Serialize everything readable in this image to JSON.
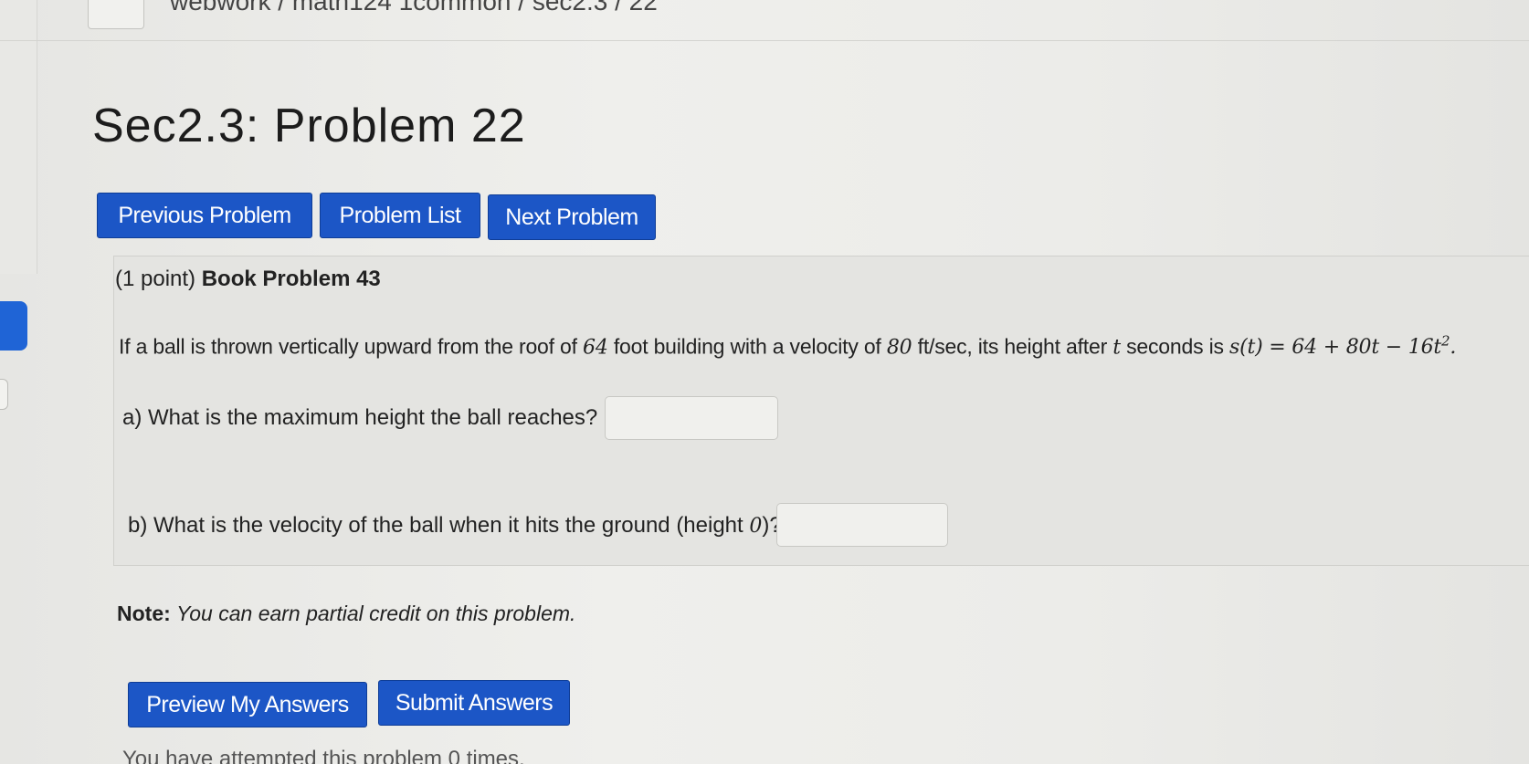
{
  "header": {
    "breadcrumb": "webwork / math124 1common / sec2.3 / 22"
  },
  "page_title": "Sec2.3: Problem 22",
  "nav": {
    "previous": "Previous Problem",
    "list": "Problem List",
    "next": "Next Problem"
  },
  "problem": {
    "points": "(1 point)",
    "book_ref": "Book Problem 43",
    "statement_prefix": "If a ball is thrown vertically upward from the roof of",
    "building_height": "64",
    "statement_mid1": "foot building with a velocity of",
    "velocity": "80",
    "statement_mid2": "ft/sec, its height after",
    "var_t": "t",
    "statement_mid3": "seconds is",
    "formula_lhs": "s(t)",
    "formula_rhs": "= 64 + 80t − 16t",
    "formula_exp": "2",
    "formula_end": ".",
    "question_a": "a) What is the maximum height the ball reaches?",
    "answer_a": "",
    "question_b_prefix": "b) What is the velocity of the ball when it hits the ground (height",
    "question_b_zero": "0",
    "question_b_suffix": ")?",
    "answer_b": ""
  },
  "note": {
    "label": "Note:",
    "text": "You can earn partial credit on this problem."
  },
  "actions": {
    "preview": "Preview My Answers",
    "submit": "Submit Answers"
  },
  "status": {
    "attempts": "You have attempted this problem 0 times."
  },
  "colors": {
    "button_blue": "#1c56c6",
    "background": "#ececE9"
  }
}
